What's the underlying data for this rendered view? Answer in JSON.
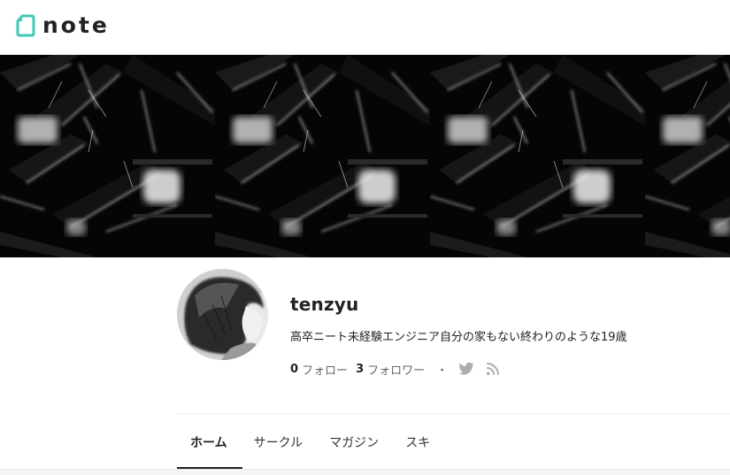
{
  "header": {
    "logo_text": "note",
    "brand_color": "#41c9b4"
  },
  "profile": {
    "username": "tenzyu",
    "bio": "高卒ニート未経験エンジニア自分の家もない終わりのような19歳",
    "following_count": "0",
    "following_label": "フォロー",
    "followers_count": "3",
    "followers_label": "フォロワー",
    "separator": "・",
    "icons": [
      "twitter-icon",
      "rss-icon"
    ]
  },
  "tabs": [
    {
      "label": "ホーム",
      "active": true
    },
    {
      "label": "サークル",
      "active": false
    },
    {
      "label": "マガジン",
      "active": false
    },
    {
      "label": "スキ",
      "active": false
    }
  ],
  "colors": {
    "icon_gray": "#a9adb0",
    "text": "#222222"
  }
}
